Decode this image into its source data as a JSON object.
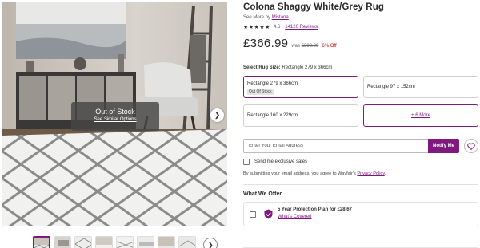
{
  "product": {
    "title": "Colona Shaggy White/Grey Rug",
    "see_more_prefix": "See More by",
    "brand": "Mistana",
    "rating_stars": 4.6,
    "rating_display": "4.6",
    "reviews_label": "14120 Reviews",
    "price": "£366.99",
    "was_prefix": "was",
    "was_price": "£383.99",
    "discount": "6% Off"
  },
  "image": {
    "out_of_stock_label": "Out of Stock",
    "similar_link": "See Similar Options",
    "next_icon": "chevron-right-icon",
    "thumbnail_count": 8,
    "active_thumbnail": 0,
    "thumbs_next_icon": "chevron-right-icon"
  },
  "size_select": {
    "label_bold": "Select Rug Size:",
    "label_value": "Rectangle 279 x 366cm",
    "options": [
      {
        "label": "Rectangle 279 x 366cm",
        "badge": "Out Of Stock",
        "selected": true
      },
      {
        "label": "Rectangle 97 x 152cm",
        "badge": "",
        "selected": false
      },
      {
        "label": "Rectangle 160 x 229cm",
        "badge": "",
        "selected": false
      }
    ],
    "more_label": "+ 6 More"
  },
  "notify": {
    "email_placeholder": "Enter Your Email Address",
    "button_label": "Notify Me",
    "heart_icon": "heart-icon",
    "checkbox_label": "Send me exclusive sales",
    "legal_text": "By submitting your email address, you agree to Wayfair's",
    "privacy_link": "Privacy Policy",
    "legal_end": "."
  },
  "offers": {
    "title": "What We Offer",
    "plan_label": "5 Year Protection Plan for £28.67",
    "covered_link": "What's Covered",
    "shield_icon": "shield-icon"
  },
  "colors": {
    "accent": "#7f187f",
    "discount": "#c40000"
  }
}
